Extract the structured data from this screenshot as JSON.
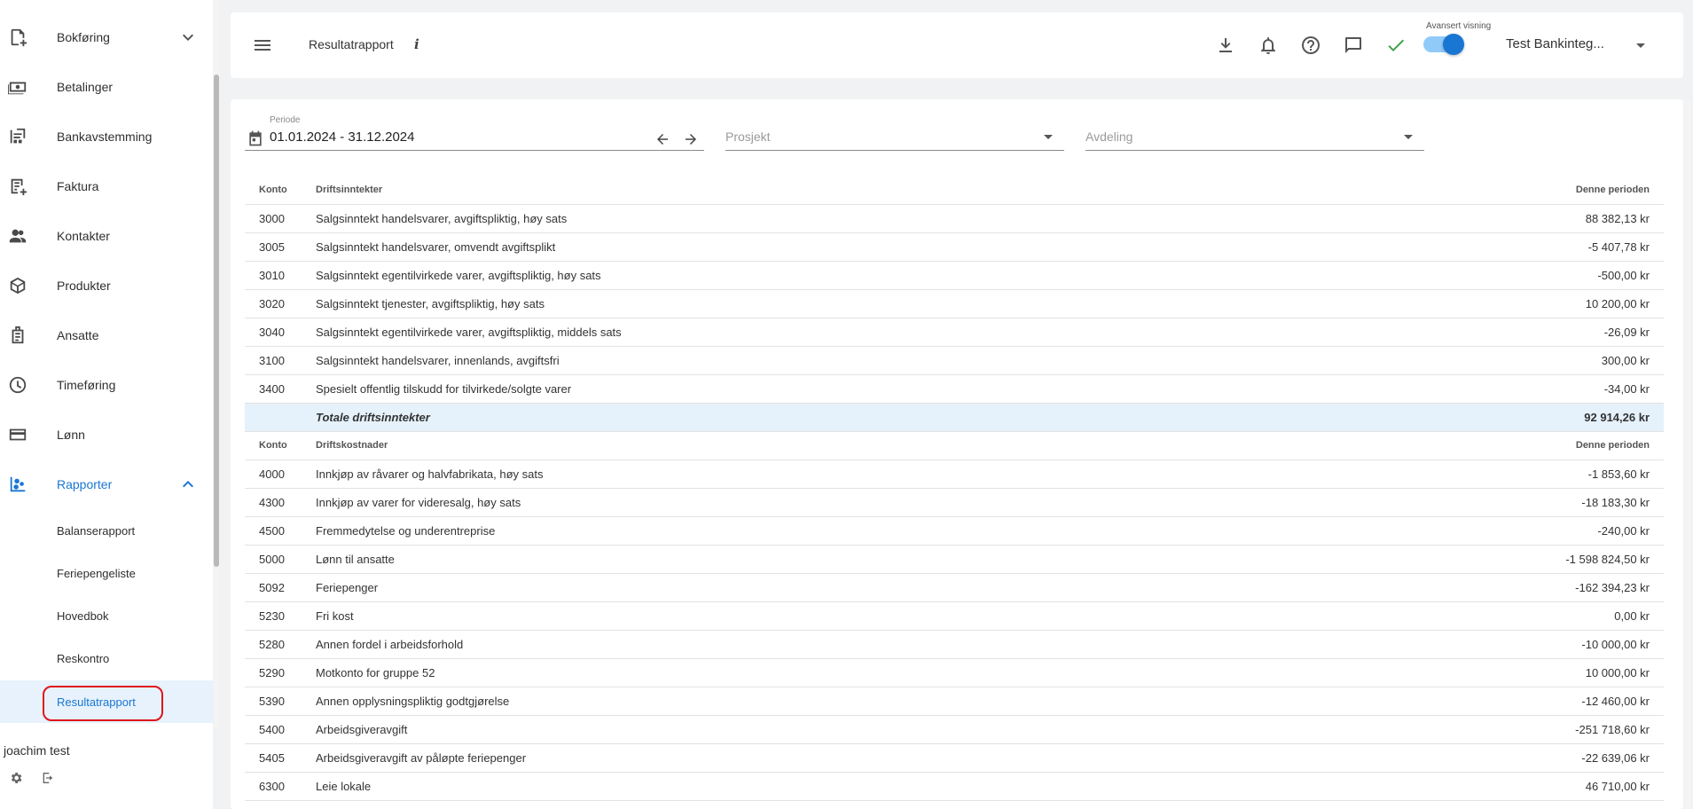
{
  "sidebar": {
    "items": [
      {
        "label": "Bokføring",
        "icon": "book-add-icon",
        "chevron": "down"
      },
      {
        "label": "Betalinger",
        "icon": "payments-icon"
      },
      {
        "label": "Bankavstemming",
        "icon": "bank-reconcile-icon"
      },
      {
        "label": "Faktura",
        "icon": "invoice-icon"
      },
      {
        "label": "Kontakter",
        "icon": "contacts-icon"
      },
      {
        "label": "Produkter",
        "icon": "products-icon"
      },
      {
        "label": "Ansatte",
        "icon": "employees-icon"
      },
      {
        "label": "Timeføring",
        "icon": "clock-icon"
      },
      {
        "label": "Lønn",
        "icon": "card-icon"
      },
      {
        "label": "Rapporter",
        "icon": "reports-icon",
        "chevron": "up",
        "active": true
      }
    ],
    "subitems": [
      {
        "label": "Balanserapport"
      },
      {
        "label": "Feriepengeliste"
      },
      {
        "label": "Hovedbok"
      },
      {
        "label": "Reskontro"
      },
      {
        "label": "Resultatrapport",
        "selected": true
      }
    ],
    "user_name": "joachim test"
  },
  "header": {
    "title": "Resultatrapport",
    "info": "i",
    "toggle_label": "Avansert visning",
    "toggle_on": true,
    "company": "Test Bankinteg..."
  },
  "filters": {
    "period_label": "Periode",
    "period_value": "01.01.2024 - 31.12.2024",
    "project_placeholder": "Prosjekt",
    "department_placeholder": "Avdeling"
  },
  "report": {
    "income": {
      "headers": {
        "konto": "Konto",
        "name": "Driftsinntekter",
        "amount": "Denne perioden"
      },
      "rows": [
        {
          "konto": "3000",
          "name": "Salgsinntekt handelsvarer, avgiftspliktig, høy sats",
          "amount": "88 382,13 kr"
        },
        {
          "konto": "3005",
          "name": "Salgsinntekt handelsvarer, omvendt avgiftsplikt",
          "amount": "-5 407,78 kr"
        },
        {
          "konto": "3010",
          "name": "Salgsinntekt egentilvirkede varer, avgiftspliktig, høy sats",
          "amount": "-500,00 kr"
        },
        {
          "konto": "3020",
          "name": "Salgsinntekt tjenester, avgiftspliktig, høy sats",
          "amount": "10 200,00 kr"
        },
        {
          "konto": "3040",
          "name": "Salgsinntekt egentilvirkede varer, avgiftspliktig, middels sats",
          "amount": "-26,09 kr"
        },
        {
          "konto": "3100",
          "name": "Salgsinntekt handelsvarer, innenlands, avgiftsfri",
          "amount": "300,00 kr"
        },
        {
          "konto": "3400",
          "name": "Spesielt offentlig tilskudd for tilvirkede/solgte varer",
          "amount": "-34,00 kr"
        }
      ],
      "total": {
        "name": "Totale driftsinntekter",
        "amount": "92 914,26 kr"
      }
    },
    "costs": {
      "headers": {
        "konto": "Konto",
        "name": "Driftskostnader",
        "amount": "Denne perioden"
      },
      "rows": [
        {
          "konto": "4000",
          "name": "Innkjøp av råvarer og halvfabrikata, høy sats",
          "amount": "-1 853,60 kr"
        },
        {
          "konto": "4300",
          "name": "Innkjøp av varer for videresalg, høy sats",
          "amount": "-18 183,30 kr"
        },
        {
          "konto": "4500",
          "name": "Fremmedytelse og underentreprise",
          "amount": "-240,00 kr"
        },
        {
          "konto": "5000",
          "name": "Lønn til ansatte",
          "amount": "-1 598 824,50 kr"
        },
        {
          "konto": "5092",
          "name": "Feriepenger",
          "amount": "-162 394,23 kr"
        },
        {
          "konto": "5230",
          "name": "Fri kost",
          "amount": "0,00 kr"
        },
        {
          "konto": "5280",
          "name": "Annen fordel i arbeidsforhold",
          "amount": "-10 000,00 kr"
        },
        {
          "konto": "5290",
          "name": "Motkonto for gruppe 52",
          "amount": "10 000,00 kr"
        },
        {
          "konto": "5390",
          "name": "Annen opplysningspliktig godtgjørelse",
          "amount": "-12 460,00 kr"
        },
        {
          "konto": "5400",
          "name": "Arbeidsgiveravgift",
          "amount": "-251 718,60 kr"
        },
        {
          "konto": "5405",
          "name": "Arbeidsgiveravgift av påløpte feriepenger",
          "amount": "-22 639,06 kr"
        },
        {
          "konto": "6300",
          "name": "Leie lokale",
          "amount": "46 710,00 kr"
        }
      ]
    }
  },
  "colors": {
    "accent": "#1976d2",
    "selected_bg": "#e7f2fc",
    "total_bg": "#e5f1fb",
    "highlight": "#e0151b",
    "check": "#3aa34b"
  }
}
